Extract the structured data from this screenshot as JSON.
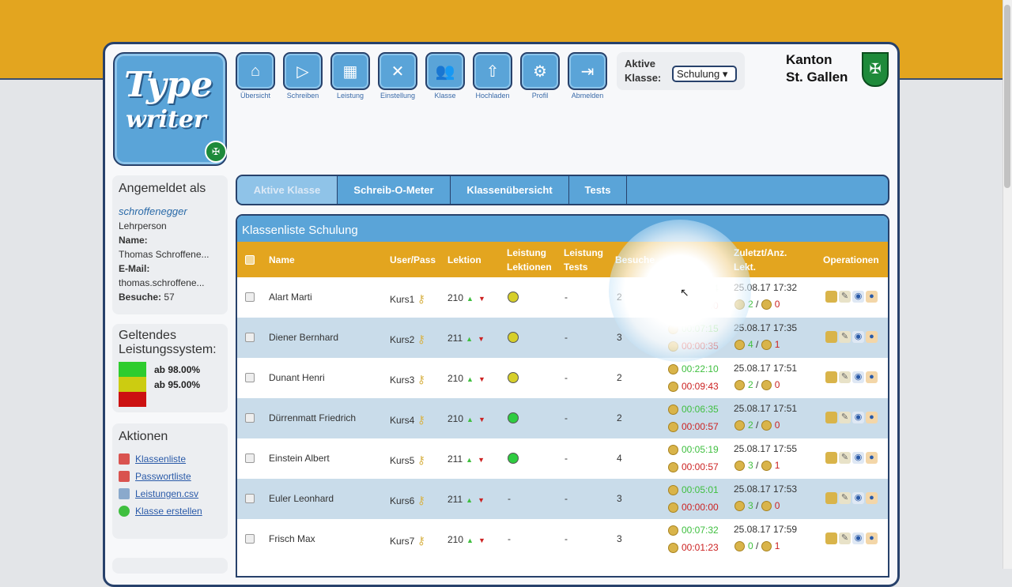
{
  "nav": [
    {
      "label": "Übersicht",
      "icon": "home-icon",
      "glyph": "⌂"
    },
    {
      "label": "Schreiben",
      "icon": "play-icon",
      "glyph": "▷"
    },
    {
      "label": "Leistung",
      "icon": "blocks-icon",
      "glyph": "▦"
    },
    {
      "label": "Einstellung",
      "icon": "tools-icon",
      "glyph": "✕"
    },
    {
      "label": "Klasse",
      "icon": "people-icon",
      "glyph": "👥"
    },
    {
      "label": "Hochladen",
      "icon": "upload-icon",
      "glyph": "⇧"
    },
    {
      "label": "Profil",
      "icon": "gear-icon",
      "glyph": "⚙"
    },
    {
      "label": "Abmelden",
      "icon": "logout-icon",
      "glyph": "⇥"
    }
  ],
  "active_class": {
    "label": "Aktive Klasse:",
    "value": "Schulung ▾"
  },
  "kanton": {
    "line1": "Kanton",
    "line2": "St. Gallen"
  },
  "logo": {
    "line1": "Type",
    "line2": "writer"
  },
  "login": {
    "title": "Angemeldet als",
    "username": "schroffenegger",
    "role": "Lehrperson",
    "name_label": "Name:",
    "name": "Thomas Schroffene...",
    "email_label": "E-Mail:",
    "email": "thomas.schroffene...",
    "visits_label": "Besuche:",
    "visits": "57"
  },
  "grading": {
    "title": "Geltendes Leistungssystem:",
    "levels": [
      {
        "label": "ab 98.00%",
        "color": "#2ecc2e"
      },
      {
        "label": "ab 95.00%",
        "color": "#cccc11"
      },
      {
        "label": "",
        "color": "#cc1111"
      }
    ]
  },
  "actions": {
    "title": "Aktionen",
    "items": [
      {
        "label": "Klassenliste",
        "icon": "pdf-icon",
        "color": "#d9534f"
      },
      {
        "label": "Passwortliste",
        "icon": "pdf-icon",
        "color": "#d9534f"
      },
      {
        "label": "Leistungen.csv",
        "icon": "csv-icon",
        "color": "#8aa9cc"
      },
      {
        "label": "Klasse erstellen",
        "icon": "add-icon",
        "color": "#3fbf3f"
      }
    ]
  },
  "tabs": [
    "Aktive Klasse",
    "Schreib-O-Meter",
    "Klassenübersicht",
    "Tests"
  ],
  "table": {
    "title": "Klassenliste Schulung",
    "headers": {
      "name": "Name",
      "userpass": "User/Pass",
      "lektion": "Lektion",
      "leist_lekt": "Leistung Lektionen",
      "leist_tests": "Leistung Tests",
      "besuche": "Besuche",
      "zeit": "Zeit",
      "zuletzt": "Zuletzt/Anz. Lekt.",
      "ops": "Operationen"
    },
    "rows": [
      {
        "name": "Alart Marti",
        "user": "Kurs1",
        "lektion": "210",
        "lek_status": "yellow",
        "tests": "-",
        "besuche": "2",
        "time_green": "00:04:44",
        "time_red": "00:00:00",
        "last": "25.08.17 17:32",
        "cnt_green": "2",
        "cnt_red": "0"
      },
      {
        "name": "Diener Bernhard",
        "user": "Kurs2",
        "lektion": "211",
        "lek_status": "yellow",
        "tests": "-",
        "besuche": "3",
        "time_green": "00:07:15",
        "time_red": "00:00:35",
        "last": "25.08.17 17:35",
        "cnt_green": "4",
        "cnt_red": "1"
      },
      {
        "name": "Dunant Henri",
        "user": "Kurs3",
        "lektion": "210",
        "lek_status": "yellow",
        "tests": "-",
        "besuche": "2",
        "time_green": "00:22:10",
        "time_red": "00:09:43",
        "last": "25.08.17 17:51",
        "cnt_green": "2",
        "cnt_red": "0"
      },
      {
        "name": "Dürrenmatt Friedrich",
        "user": "Kurs4",
        "lektion": "210",
        "lek_status": "green",
        "tests": "-",
        "besuche": "2",
        "time_green": "00:06:35",
        "time_red": "00:00:57",
        "last": "25.08.17 17:51",
        "cnt_green": "2",
        "cnt_red": "0"
      },
      {
        "name": "Einstein Albert",
        "user": "Kurs5",
        "lektion": "211",
        "lek_status": "green",
        "tests": "-",
        "besuche": "4",
        "time_green": "00:05:19",
        "time_red": "00:00:57",
        "last": "25.08.17 17:55",
        "cnt_green": "3",
        "cnt_red": "1"
      },
      {
        "name": "Euler Leonhard",
        "user": "Kurs6",
        "lektion": "211",
        "lek_status": "none",
        "tests": "-",
        "besuche": "3",
        "time_green": "00:05:01",
        "time_red": "00:00:00",
        "last": "25.08.17 17:53",
        "cnt_green": "3",
        "cnt_red": "0"
      },
      {
        "name": "Frisch Max",
        "user": "Kurs7",
        "lektion": "210",
        "lek_status": "none",
        "tests": "-",
        "besuche": "3",
        "time_green": "00:07:32",
        "time_red": "00:01:23",
        "last": "25.08.17 17:59",
        "cnt_green": "0",
        "cnt_red": "1"
      }
    ]
  },
  "colors": {
    "accent_blue": "#5aa4d8",
    "header_orange": "#e3a51f",
    "frame_navy": "#27416b"
  }
}
